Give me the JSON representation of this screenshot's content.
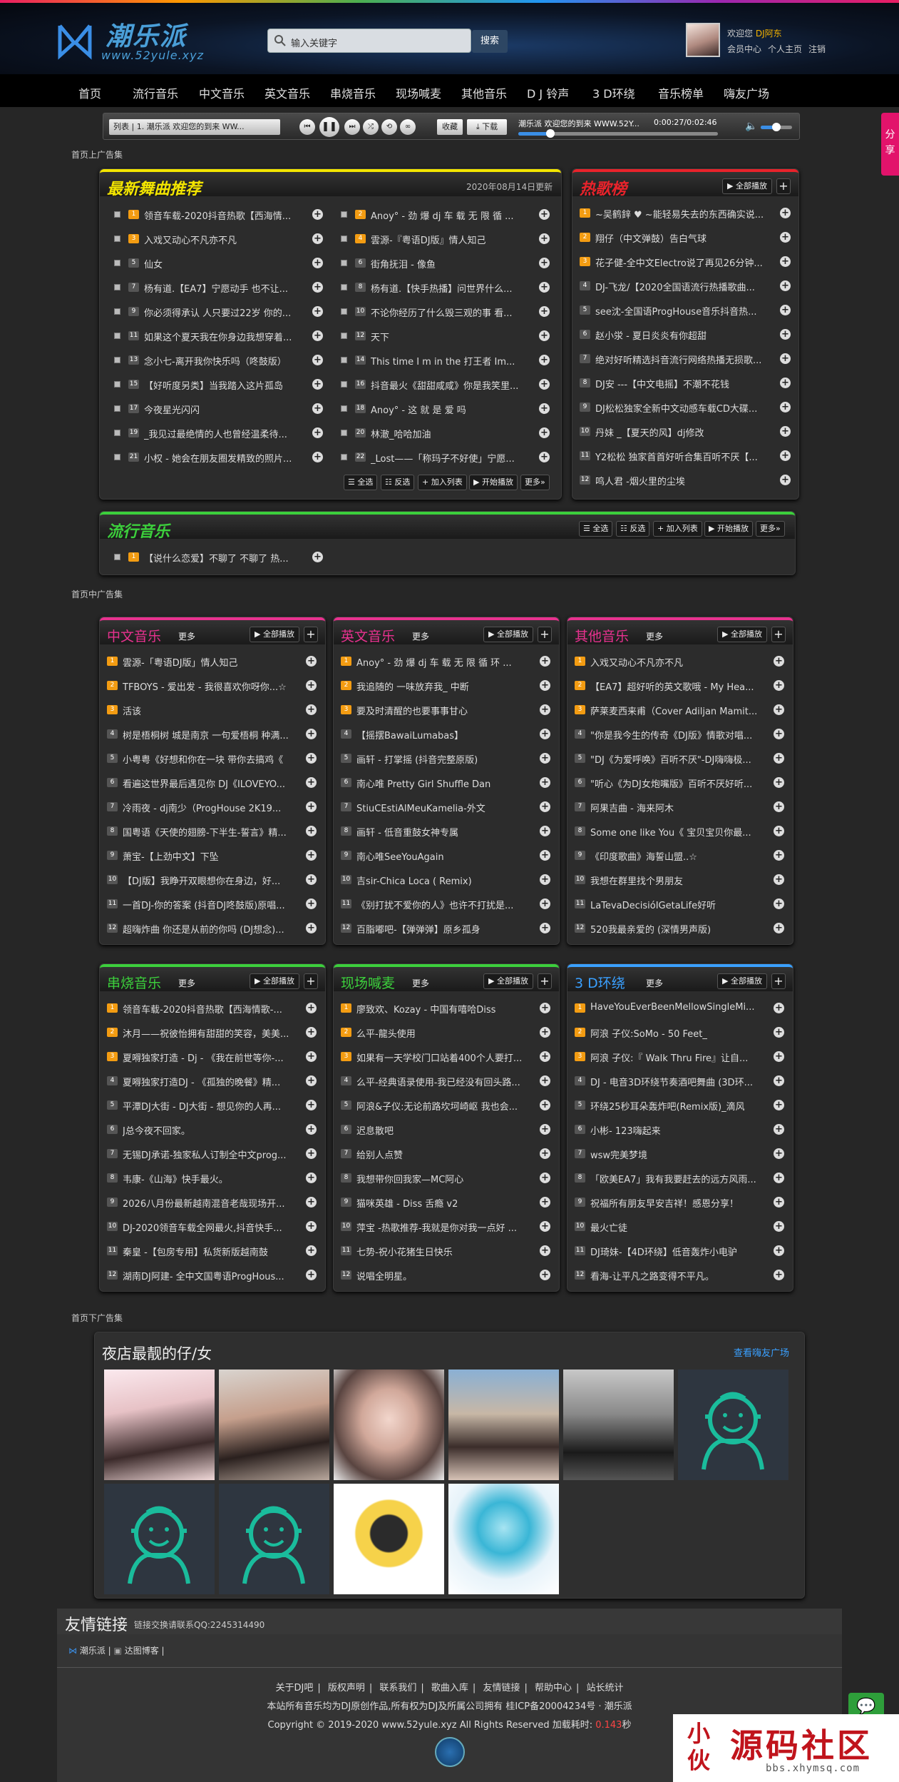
{
  "header": {
    "logo_name": "潮乐派",
    "logo_url": "www.52yule.xyz",
    "search_placeholder": "输入关键字",
    "search_button": "搜索",
    "welcome_prefix": "欢迎您",
    "username": "DJ阿东",
    "user_links": [
      "会员中心",
      "个人主页",
      "注销"
    ]
  },
  "nav": [
    "首页",
    "流行音乐",
    "中文音乐",
    "英文音乐",
    "串烧音乐",
    "现场喊麦",
    "其他音乐",
    "D J 铃声",
    "3 D环绕",
    "音乐榜单",
    "嗨友广场"
  ],
  "share_label": "分享",
  "player": {
    "list_label": "列表",
    "list_current": "1. 潮乐派 欢迎您的到来 WW...",
    "collect": "收藏",
    "download": "下载",
    "now_playing": "潮乐派 欢迎您的到来 WWW.52Y...",
    "time": "0:00:27/0:02:46",
    "progress": 0.16,
    "volume": 0.4
  },
  "ads": {
    "top": "首页上广告集",
    "middle": "首页中广告集",
    "bottom": "首页下广告集"
  },
  "new_songs": {
    "title": "最新舞曲推荐",
    "date": "2020年08月14日更新",
    "left": [
      {
        "n": "1",
        "t": "领音车载-2020抖音热歌【西海情..."
      },
      {
        "n": "3",
        "t": "入戏又动心不凡亦不凡"
      },
      {
        "n": "5",
        "t": "仙女"
      },
      {
        "n": "7",
        "t": "杨有道.【EA7】宁愿动手 也不让..."
      },
      {
        "n": "9",
        "t": "你必须得承认 人只要过22岁 你的..."
      },
      {
        "n": "11",
        "t": "如果这个夏天我在你身边我想穿着..."
      },
      {
        "n": "13",
        "t": "念小七-离开我你快乐吗（咚鼓版）"
      },
      {
        "n": "15",
        "t": "【好听度另类】当我踏入这片孤岛"
      },
      {
        "n": "17",
        "t": "今夜星光闪闪"
      },
      {
        "n": "19",
        "t": "_我见过最绝情的人也曾经温柔待..."
      },
      {
        "n": "21",
        "t": "小权 - 她会在朋友圈发精致的照片..."
      }
    ],
    "right": [
      {
        "n": "2",
        "t": "Anoy° - 劲 爆 dj 车 载 无 限 循 ..."
      },
      {
        "n": "4",
        "t": "雲源-『粤语DJ版』情人知己"
      },
      {
        "n": "6",
        "t": "街角抚泪 - 像鱼"
      },
      {
        "n": "8",
        "t": "杨有道.【快手热播】问世界什么..."
      },
      {
        "n": "10",
        "t": "不论你经历了什么毁三观的事 看..."
      },
      {
        "n": "12",
        "t": "天下"
      },
      {
        "n": "14",
        "t": "This time I m in the 打王者 Im..."
      },
      {
        "n": "16",
        "t": "抖音最火《甜甜咸咸》你是我笑里..."
      },
      {
        "n": "18",
        "t": "Anoy° - 这 就 是 爱 吗"
      },
      {
        "n": "20",
        "t": "林澈_哈哈加油"
      },
      {
        "n": "22",
        "t": "_Lost——「称玛子不好使」宁愿..."
      }
    ],
    "buttons": [
      "全选",
      "反选",
      "加入列表",
      "开始播放",
      "更多»"
    ]
  },
  "hot": {
    "title": "热歌榜",
    "play_all": "全部播放",
    "items": [
      {
        "n": "1",
        "t": "~吴鹤鋅 ♥ ~能轻易失去的东西确实说..."
      },
      {
        "n": "2",
        "t": "翔仔（中文弹鼓）告白气球"
      },
      {
        "n": "3",
        "t": "花子健-全中文Electro说了再见26分钟..."
      },
      {
        "n": "4",
        "t": "DJ-飞龙/【2020全国语流行热播歌曲..."
      },
      {
        "n": "5",
        "t": "see沈-全国语ProgHouse音乐抖音热..."
      },
      {
        "n": "6",
        "t": "赵小泶 - 夏日炎炎有你超甜"
      },
      {
        "n": "7",
        "t": "绝对好听精选抖音流行网络热播无损歌..."
      },
      {
        "n": "8",
        "t": "DJ安 ---【中文电摇】不潮不花钱"
      },
      {
        "n": "9",
        "t": "DJ松松独家全新中文动感车载CD大碟..."
      },
      {
        "n": "10",
        "t": "丹妹 _【夏天的风】dj修改"
      },
      {
        "n": "11",
        "t": "Y2松松 独家首首好听合集百听不厌【..."
      },
      {
        "n": "12",
        "t": "鸣人君 -烟火里的尘埃"
      }
    ]
  },
  "pop": {
    "title": "流行音乐",
    "buttons": [
      "全选",
      "反选",
      "加入列表",
      "开始播放",
      "更多»"
    ],
    "items": [
      {
        "n": "1",
        "t": "【说什么恋爱】不聊了 不聊了 热..."
      }
    ]
  },
  "categories_row1": [
    {
      "title": "中文音乐",
      "color": "#e8318f",
      "more": "更多",
      "play_all": "全部播放",
      "items": [
        "雲源-「粤语DJ版」情人知己",
        "TFBOYS - 爱出发 - 我很喜欢你呀你...☆",
        "活该",
        "树是梧桐树 城是南京 一句爱梧桐 种满...",
        "小粤粤《好想和你在一块 带你去搞鸡《",
        "看遍这世界最后遇见你 DJ《ILOVEYO...",
        "冷雨夜 - dj南少（ProgHouse 2K19...",
        "国粤语《天使的翅膀-下半生-誓言》精...",
        "萧宝-【上劲中文】下坠",
        "【DJ版】我睁开双眼想你在身边，好...",
        "一首DJ-你的答案 (抖音DJ咚鼓版)原唱...",
        "超嗨炸曲 你还是从前的你吗 (DJ想念)..."
      ]
    },
    {
      "title": "英文音乐",
      "color": "#e8318f",
      "more": "更多",
      "play_all": "全部播放",
      "items": [
        "Anoy° - 劲 爆 dj 车 载 无 限 循 环 ...",
        "我追随的 一味放弃我_ 中断",
        "要及时清醒的也要事事甘心",
        "【摇摆BawaiLumabas】",
        "画轩 - 打掌摇 (抖音完整原版)",
        "南心唯 Pretty Girl Shuffle Dan",
        "StiuCEstiAlMeuKamelia-外文",
        "画轩 - 低音重鼓女神专属",
        "南心唯SeeYouAgain",
        "吉sir-Chica Loca ( Remix)",
        "《别打扰不爱你的人》也许不打扰是...",
        "百脂嘟吧-【弹弹弹】原乡孤身"
      ]
    },
    {
      "title": "其他音乐",
      "color": "#e8318f",
      "more": "更多",
      "play_all": "全部播放",
      "items": [
        "入戏又动心不凡亦不凡",
        "【EA7】超好听的英文歌哦 - My Hea...",
        "萨莱麦西来甫（Cover Adiljan Mamit...",
        "\"你是我今生的传奇《DJ版》情歌对唱...",
        "\"DJ《为爱呼唤》百听不厌\"-DJ嗨嗨极...",
        "\"听心《为DJ女炮嘴版》百听不厌好听...",
        "阿果吉曲 - 海来阿木",
        "Some one like You《 宝贝宝贝你最...",
        "《印度歌曲》海誓山盟..☆",
        "我想在群里找个男朋友",
        "LaTevaDecisióIGetaLife好听",
        "520我最亲爱的 (深情男声版)"
      ]
    }
  ],
  "categories_row2": [
    {
      "title": "串烧音乐",
      "color": "#3ccf3c",
      "more": "更多",
      "play_all": "全部播放",
      "items": [
        "领音车载-2020抖音热歌【西海情歌-...",
        "沐月——祝彼怡拥有甜甜的笑容，美美...",
        "夏嘚独家打造 - Dj - 《我在前世等你-...",
        "夏嘚独家打造DJ - 《孤独的晚餐》精...",
        "平潭DJ大街 - DJ大街 - 想见你的人再...",
        "J总今夜不回家。",
        "无锡DJ承诺-独家私人订制全中文prog...",
        "韦康-《山海》快手最火。",
        "2026八月份最新越南混音老哉现场开...",
        "DJ-2020领音车载全网最火,抖音快手...",
        "秦皇 -【包房专用】私货新版越南鼓",
        "湖南DJ阿建- 全中文国粤语ProgHous..."
      ]
    },
    {
      "title": "现场喊麦",
      "color": "#3ccf3c",
      "more": "更多",
      "play_all": "全部播放",
      "items": [
        "廖致欢、Kozay - 中国有嘻哈Diss",
        "么平-龍头使用",
        "如果有一天学校门口站着400个人要打...",
        "么平-经典语录使用-我已经没有回头路...",
        "阿浪&子仪:无论前路坎坷崎岖 我也会...",
        "迟息散吧",
        "给别人点赞",
        "我想带你回我家—MC阿心",
        "猫咪英雄 - Diss 舌瘾 v2",
        "萍宝 -热歌推荐-我就是你对我一点好 ...",
        "七势-祝小花猪生日快乐",
        "说唱全明星。"
      ]
    },
    {
      "title": "3 D环绕",
      "color": "#3aa0ff",
      "more": "更多",
      "play_all": "全部播放",
      "items": [
        "HaveYouEverBeenMellowSingleMi...",
        "阿浪 子仪:SoMo - 50 Feet_",
        "阿浪 子仪:『 Walk Thru Fire』让自...",
        "DJ - 电音3D环绕节奏酒吧舞曲 (3D环...",
        "环绕25秒耳朵轰炸吧(Remix版)_滴风",
        "小彬- 123嗨起来",
        "wsw完美梦境",
        "「欧美EA7」我有我要赶去的远方风雨...",
        "祝福所有朋友早安吉祥！感恩分享！",
        "最火亡徒",
        "DJ琦妹-【4D环绕】低音轰炸小电驴",
        "看海-让平凡之路变得不平凡。"
      ]
    }
  ],
  "members": {
    "title": "夜店最靓的仔/女",
    "link": "查看嗨友广场",
    "photos": [
      "photo-1",
      "photo-2",
      "photo-3",
      "photo-4",
      "photo-5",
      "default-avatar",
      "default-avatar",
      "default-avatar",
      "photo-6",
      "photo-7"
    ]
  },
  "friends": {
    "title": "友情链接",
    "note": "链接交换请联系QQ:2245314490",
    "links": [
      "潮乐派",
      "达图博客"
    ]
  },
  "footer": {
    "links": [
      "关于DJ吧",
      "版权声明",
      "联系我们",
      "歌曲入库",
      "友情链接",
      "帮助中心",
      "站长统计"
    ],
    "note": "本站所有音乐均为DJ原创作品,所有权为DJ及所属公司拥有 桂ICP备20004234号 · 潮乐派",
    "copyright": "Copyright © 2019-2020 www.52yule.xyz All Rights Reserved 加载耗时:",
    "load_time": "0.143",
    "load_unit": "秒",
    "watermark_main": "源码社区",
    "watermark_sub": "bbs.xhymsq.com",
    "watermark_mark": "小伙"
  }
}
